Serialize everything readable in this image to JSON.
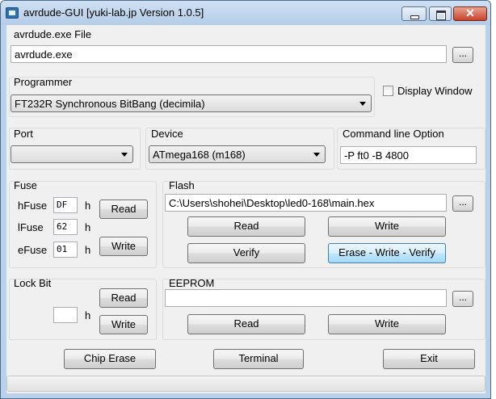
{
  "window": {
    "title": "avrdude-GUI [yuki-lab.jp Version 1.0.5]",
    "close_glyph": "✕"
  },
  "avrdude": {
    "label": "avrdude.exe File",
    "value": "avrdude.exe",
    "browse": "..."
  },
  "programmer": {
    "label": "Programmer",
    "selected": "FT232R Synchronous BitBang (decimila)"
  },
  "display_window": {
    "label": "Display Window",
    "checked": false
  },
  "port": {
    "label": "Port",
    "selected": ""
  },
  "device": {
    "label": "Device",
    "selected": "ATmega168 (m168)"
  },
  "cmdline": {
    "label": "Command line Option",
    "value": "-P ft0 -B 4800"
  },
  "fuse": {
    "label": "Fuse",
    "hfuse_label": "hFuse",
    "hfuse_value": "DF",
    "lfuse_label": "lFuse",
    "lfuse_value": "62",
    "efuse_label": "eFuse",
    "efuse_value": "01",
    "unit": "h",
    "read": "Read",
    "write": "Write"
  },
  "flash": {
    "label": "Flash",
    "path": "C:\\Users\\shohei\\Desktop\\led0-168\\main.hex",
    "browse": "...",
    "read": "Read",
    "write": "Write",
    "verify": "Verify",
    "erase_write_verify": "Erase - Write - Verify"
  },
  "lockbit": {
    "label": "Lock Bit",
    "value": "",
    "unit": "h",
    "read": "Read",
    "write": "Write"
  },
  "eeprom": {
    "label": "EEPROM",
    "path": "",
    "browse": "...",
    "read": "Read",
    "write": "Write"
  },
  "bottom": {
    "chip_erase": "Chip Erase",
    "terminal": "Terminal",
    "exit": "Exit"
  },
  "colors": {
    "title_bar": "#b9d1ea",
    "client": "#f0f0f0",
    "close_button": "#c7432b",
    "focus_button": "#a7d9f5"
  },
  "icons": [
    "app-icon",
    "minimize-icon",
    "maximize-icon",
    "close-icon",
    "chevron-down-icon"
  ]
}
